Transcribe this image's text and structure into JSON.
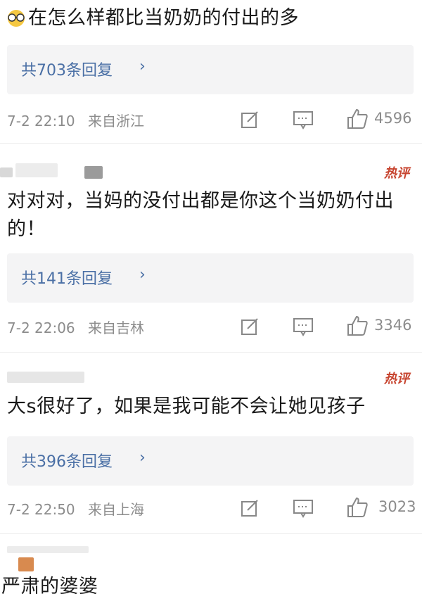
{
  "comment1": {
    "text": "在怎么样都比当奶奶的付出的多",
    "replies": "共703条回复",
    "time": "7-2 22:10",
    "location": "来自浙江",
    "likes": "4596"
  },
  "comment2": {
    "hot": "热评",
    "text": "对对对，当妈的没付出都是你这个当奶奶付出的！",
    "replies": "共141条回复",
    "time": "7-2 22:06",
    "location": "来自吉林",
    "likes": "3346"
  },
  "comment3": {
    "hot": "热评",
    "text": "大s很好了，如果是我可能不会让她见孩子",
    "replies": "共396条回复",
    "time": "7-2 22:50",
    "location": "来自上海",
    "likes": "3023"
  },
  "comment4": {
    "text": "严肃的婆婆"
  },
  "icons": {
    "share": "share-icon",
    "comment": "comment-icon",
    "like": "thumbs-up-icon",
    "reply_chevron": "chevron-right-icon",
    "emoji": "emoji-glasses-icon"
  },
  "colors": {
    "link": "#4a6fa5",
    "hot": "#c7442f",
    "meta": "#8c8c8c"
  }
}
